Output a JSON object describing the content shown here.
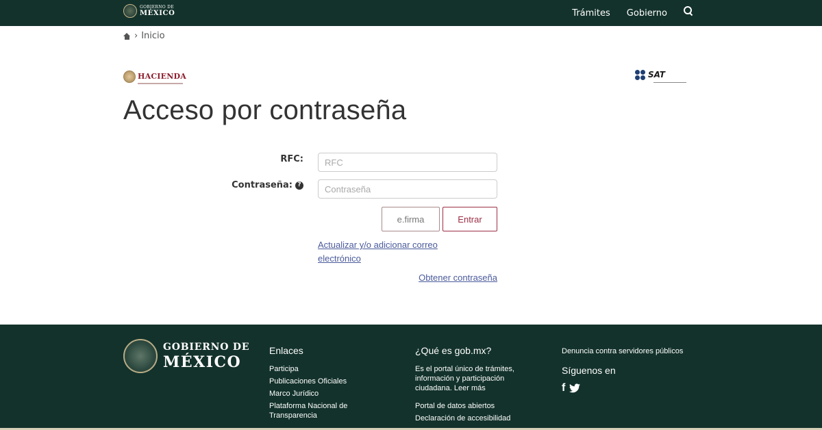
{
  "header": {
    "logo_line1": "GOBIERNO DE",
    "logo_line2": "MÉXICO",
    "nav": [
      {
        "label": "Trámites"
      },
      {
        "label": "Gobierno"
      }
    ]
  },
  "breadcrumb": {
    "separator": "›",
    "current": "Inicio"
  },
  "logos": {
    "hacienda": "HACIENDA",
    "sat": "SAT"
  },
  "page": {
    "title": "Acceso por contraseña"
  },
  "form": {
    "rfc_label": "RFC:",
    "rfc_placeholder": "RFC",
    "password_label": "Contraseña:",
    "password_placeholder": "Contraseña",
    "info_glyph": "?",
    "efirma_button": "e.firma",
    "submit_button": "Entrar",
    "update_email_link": "Actualizar y/o adicionar correo electrónico",
    "obtain_password_link": "Obtener contraseña"
  },
  "footer": {
    "logo_line1": "GOBIERNO DE",
    "logo_line2": "MÉXICO",
    "enlaces_title": "Enlaces",
    "enlaces": [
      "Participa",
      "Publicaciones Oficiales",
      "Marco Jurídico",
      "Plataforma Nacional de Transparencia"
    ],
    "que_title": "¿Qué es gob.mx?",
    "que_text": "Es el portal único de trámites, información y participación ciudadana. Leer más",
    "que_links": [
      "Portal de datos abiertos",
      "Declaración de accesibilidad"
    ],
    "denuncia_link": "Denuncia contra servidores públicos",
    "siguenos_title": "Síguenos en",
    "facebook_glyph": "f"
  },
  "colors": {
    "header_bg": "#13322b",
    "entrar_border": "#9b2e44",
    "link": "#4a5a9b",
    "hacienda_text": "#8a1c2b"
  },
  "icons": [
    "home-icon",
    "search-icon",
    "info-icon",
    "facebook-icon",
    "twitter-icon"
  ]
}
